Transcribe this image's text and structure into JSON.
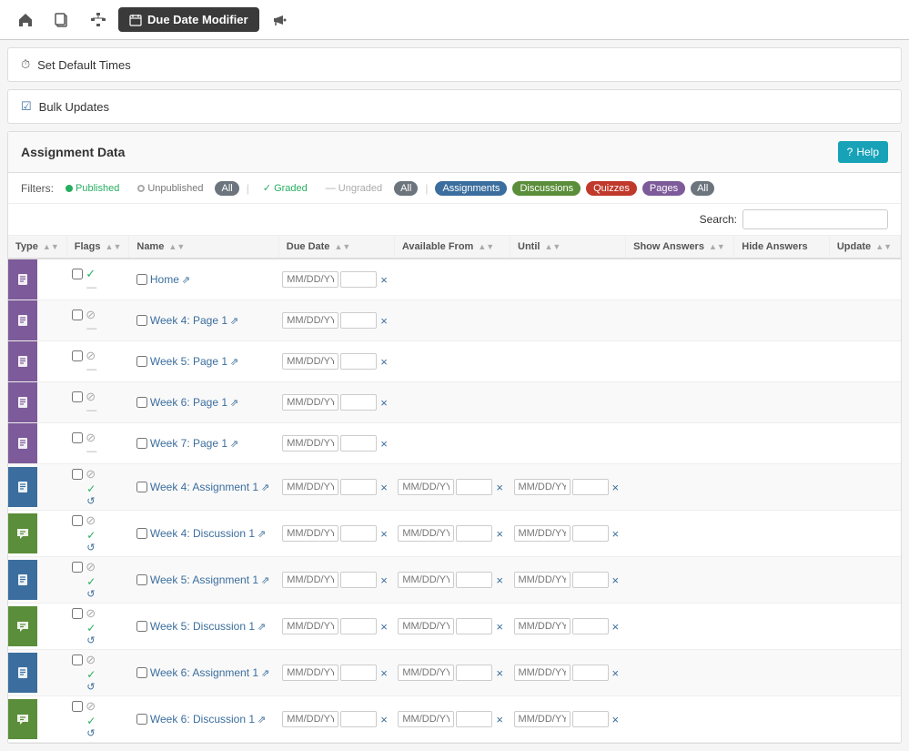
{
  "topNav": {
    "icons": [
      {
        "name": "home-icon",
        "symbol": "⌂"
      },
      {
        "name": "copy-icon",
        "symbol": "⧉"
      },
      {
        "name": "sitemap-icon",
        "symbol": "⊞"
      }
    ],
    "activeTab": "Due Date Modifier",
    "activeTabIcon": "📅",
    "megaphone-icon": "📣"
  },
  "accordion1": {
    "label": "Set Default Times",
    "icon": "⏱"
  },
  "accordion2": {
    "label": "Bulk Updates",
    "icon": "☑"
  },
  "mainSection": {
    "title": "Assignment Data",
    "helpLabel": "? Help"
  },
  "filters": {
    "label": "Filters:",
    "published": "Published",
    "unpublished": "Unpublished",
    "all1": "All",
    "graded": "Graded",
    "ungraded": "Ungraded",
    "all2": "All",
    "assignments": "Assignments",
    "discussions": "Discussions",
    "quizzes": "Quizzes",
    "pages": "Pages",
    "all3": "All"
  },
  "search": {
    "label": "Search:",
    "placeholder": ""
  },
  "table": {
    "columns": [
      "Type",
      "Flags",
      "Name",
      "Due Date",
      "Available From",
      "Until",
      "Show Answers",
      "Hide Answers",
      "Update"
    ],
    "datePlaceholder": "MM/DD/YY",
    "timePlaceholder": "",
    "rows": [
      {
        "iconClass": "icon-page",
        "iconSymbol": "📄",
        "flagSymbol": "✓",
        "flagClass": "flag-green",
        "subFlag": "—",
        "name": "Home",
        "hasArrow": true,
        "type": "page",
        "hasDueDate": true,
        "hasAvailableFrom": false,
        "hasUntil": false,
        "nameLink": true
      },
      {
        "iconClass": "icon-page",
        "iconSymbol": "🚫",
        "flagSymbol": "🚫",
        "flagClass": "flag-icon",
        "subFlag": "—",
        "name": "Week 4: Page 1",
        "hasArrow": true,
        "type": "page",
        "hasDueDate": true,
        "hasAvailableFrom": false,
        "hasUntil": false
      },
      {
        "iconClass": "icon-page",
        "iconSymbol": "🚫",
        "flagSymbol": "🚫",
        "flagClass": "flag-icon",
        "subFlag": "—",
        "name": "Week 5: Page 1",
        "hasArrow": true,
        "type": "page",
        "hasDueDate": true,
        "hasAvailableFrom": false,
        "hasUntil": false
      },
      {
        "iconClass": "icon-page",
        "iconSymbol": "🚫",
        "flagSymbol": "🚫",
        "flagClass": "flag-icon",
        "subFlag": "—",
        "name": "Week 6: Page 1",
        "hasArrow": true,
        "type": "page",
        "hasDueDate": true,
        "hasAvailableFrom": false,
        "hasUntil": false
      },
      {
        "iconClass": "icon-page",
        "iconSymbol": "🚫",
        "flagSymbol": "🚫",
        "flagClass": "flag-icon",
        "subFlag": "—",
        "name": "Week 7: Page 1",
        "hasArrow": true,
        "type": "page",
        "hasDueDate": true,
        "hasAvailableFrom": false,
        "hasUntil": false
      },
      {
        "iconClass": "icon-assignment",
        "iconSymbol": "📝",
        "flagSymbol": "🚫",
        "flagClass": "flag-icon",
        "subFlagSymbol": "✓",
        "subFlagClass": "flag-green",
        "name": "Week 4: Assignment 1",
        "hasArrow": true,
        "type": "assignment",
        "hasDueDate": true,
        "hasAvailableFrom": true,
        "hasUntil": true
      },
      {
        "iconClass": "icon-discussion",
        "iconSymbol": "💬",
        "flagSymbol": "🚫",
        "flagClass": "flag-icon",
        "subFlagSymbol": "✓",
        "subFlagClass": "flag-green",
        "name": "Week 4: Discussion 1",
        "hasArrow": true,
        "type": "discussion",
        "hasDueDate": true,
        "hasAvailableFrom": true,
        "hasUntil": true
      },
      {
        "iconClass": "icon-assignment",
        "iconSymbol": "📝",
        "flagSymbol": "🚫",
        "flagClass": "flag-icon",
        "subFlagSymbol": "✓",
        "subFlagClass": "flag-green",
        "name": "Week 5: Assignment 1",
        "hasArrow": true,
        "type": "assignment",
        "hasDueDate": true,
        "hasAvailableFrom": true,
        "hasUntil": true
      },
      {
        "iconClass": "icon-discussion",
        "iconSymbol": "💬",
        "flagSymbol": "🚫",
        "flagClass": "flag-icon",
        "subFlagSymbol": "✓",
        "subFlagClass": "flag-green",
        "name": "Week 5: Discussion 1",
        "hasArrow": true,
        "type": "discussion",
        "hasDueDate": true,
        "hasAvailableFrom": true,
        "hasUntil": true
      },
      {
        "iconClass": "icon-assignment",
        "iconSymbol": "📝",
        "flagSymbol": "🚫",
        "flagClass": "flag-icon",
        "subFlagSymbol": "✓",
        "subFlagClass": "flag-green",
        "name": "Week 6: Assignment 1",
        "hasArrow": true,
        "type": "assignment",
        "hasDueDate": true,
        "hasAvailableFrom": true,
        "hasUntil": true
      },
      {
        "iconClass": "icon-discussion",
        "iconSymbol": "💬",
        "flagSymbol": "🚫",
        "flagClass": "flag-icon",
        "subFlagSymbol": "✓",
        "subFlagClass": "flag-green",
        "name": "Week 6: Discussion 1",
        "hasArrow": true,
        "type": "discussion",
        "hasDueDate": true,
        "hasAvailableFrom": true,
        "hasUntil": true
      }
    ]
  },
  "colors": {
    "pagePurple": "#7d5a99",
    "assignmentBlue": "#3b6e9e",
    "discussionGreen": "#5a8e3a",
    "quizRed": "#c0392b"
  }
}
